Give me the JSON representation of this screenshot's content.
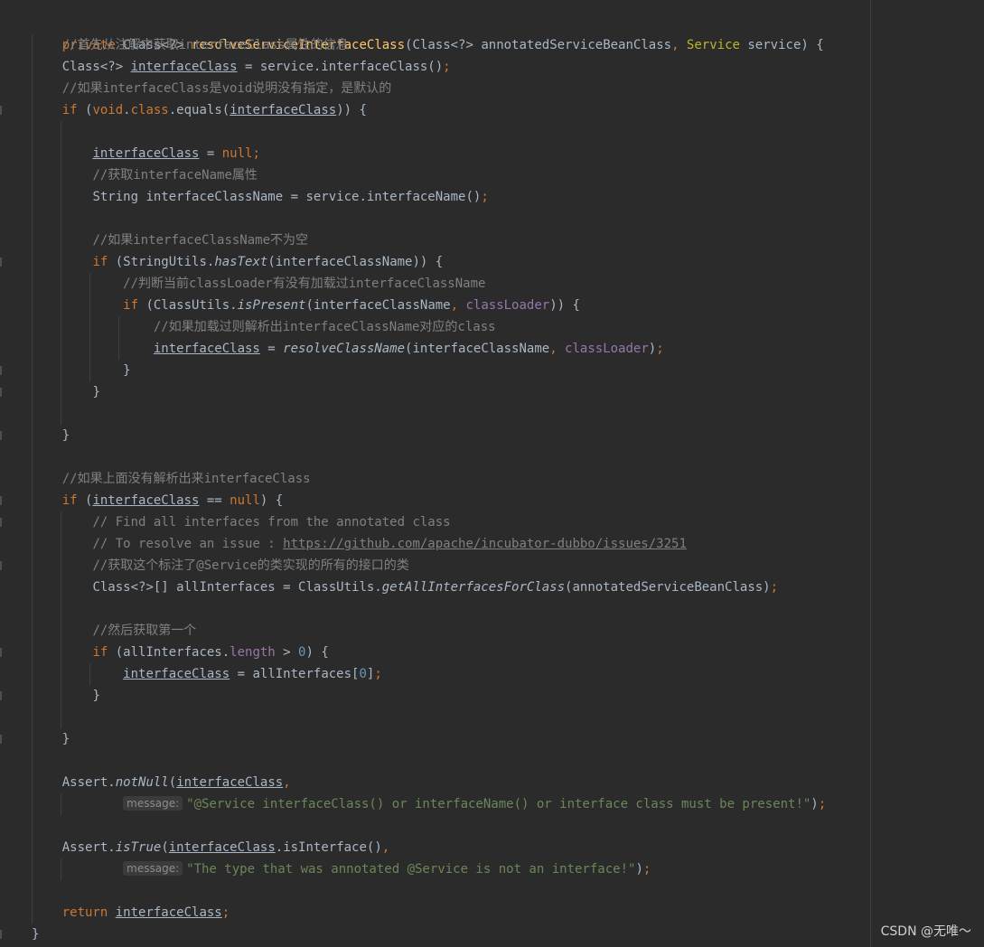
{
  "code": {
    "l1": {
      "mod": "private",
      "type": "Class<?> ",
      "method": "resolveServiceInterfaceClass",
      "params_a": "(Class<?> annotatedServiceBeanClass",
      "comma": ",",
      "svc_type": " Service",
      "params_b": " service) {"
    },
    "l2": {
      "comment": "//首先从注解中获取interfaceClass属性的信息"
    },
    "l3": {
      "type": "Class<?> ",
      "var": "interfaceClass",
      "rest": " = service.interfaceClass()",
      "semi": ";"
    },
    "l4": {
      "comment": "//如果interfaceClass是void说明没有指定，是默认的"
    },
    "l5": {
      "kw_if": "if",
      "p1": " (",
      "kw_void": "void",
      "dot": ".",
      "kw_class": "class",
      "p2": ".equals(",
      "var": "interfaceClass",
      "p3": ")) {"
    },
    "l7": {
      "var": "interfaceClass",
      "eq": " = ",
      "kw_null": "null",
      "semi": ";"
    },
    "l8": {
      "comment": "//获取interfaceName属性"
    },
    "l9": {
      "text": "String interfaceClassName = service.interfaceName()",
      "semi": ";"
    },
    "l11": {
      "comment": "//如果interfaceClassName不为空"
    },
    "l12": {
      "kw_if": "if",
      "p1": " (StringUtils.",
      "m": "hasText",
      "p2": "(interfaceClassName)) {"
    },
    "l13": {
      "comment": "//判断当前classLoader有没有加载过interfaceClassName"
    },
    "l14": {
      "kw_if": "if",
      "p1": " (ClassUtils.",
      "m": "isPresent",
      "p2": "(interfaceClassName",
      "comma": ",",
      "fld": " classLoader",
      "p3": ")) {"
    },
    "l15": {
      "comment": "//如果加载过则解析出interfaceClassName对应的class"
    },
    "l16": {
      "var": "interfaceClass",
      "eq": " = ",
      "m": "resolveClassName",
      "p1": "(interfaceClassName",
      "comma": ",",
      "fld": " classLoader",
      "p2": ")",
      "semi": ";"
    },
    "l17": {
      "brace": "}"
    },
    "l18": {
      "brace": "}"
    },
    "l20": {
      "brace": "}"
    },
    "l22": {
      "comment": "//如果上面没有解析出来interfaceClass"
    },
    "l23": {
      "kw_if": "if",
      "p1": " (",
      "var": "interfaceClass",
      "p2": " == ",
      "kw_null": "null",
      "p3": ") {"
    },
    "l24": {
      "comment": "// Find all interfaces from the annotated class"
    },
    "l25": {
      "comment": "// To resolve an issue : ",
      "link": "https://github.com/apache/incubator-dubbo/issues/3251"
    },
    "l26": {
      "comment": "//获取这个标注了@Service的类实现的所有的接口的类"
    },
    "l27": {
      "p1": "Class<?>[] allInterfaces = ClassUtils.",
      "m": "getAllInterfacesForClass",
      "p2": "(annotatedServiceBeanClass)",
      "semi": ";"
    },
    "l29": {
      "comment": "//然后获取第一个"
    },
    "l30": {
      "kw_if": "if",
      "p1": " (allInterfaces.",
      "fld": "length",
      "p2": " > ",
      "num": "0",
      "p3": ") {"
    },
    "l31": {
      "var": "interfaceClass",
      "p1": " = allInterfaces[",
      "num": "0",
      "p2": "]",
      "semi": ";"
    },
    "l32": {
      "brace": "}"
    },
    "l34": {
      "brace": "}"
    },
    "l36": {
      "p1": "Assert.",
      "m": "notNull",
      "p2": "(",
      "var": "interfaceClass",
      "comma": ","
    },
    "l37": {
      "hint": "message:",
      "str": "\"@Service interfaceClass() or interfaceName() or interface class must be present!\"",
      "p1": ")",
      "semi": ";"
    },
    "l39": {
      "p1": "Assert.",
      "m": "isTrue",
      "p2": "(",
      "var": "interfaceClass",
      "p3": ".isInterface()",
      "comma": ","
    },
    "l40": {
      "hint": "message:",
      "str": "\"The type that was annotated @Service is not an interface!\"",
      "p1": ")",
      "semi": ";"
    },
    "l42": {
      "kw_return": "return",
      "sp": " ",
      "var": "interfaceClass",
      "semi": ";"
    },
    "l43": {
      "brace": "}"
    }
  },
  "watermark": "CSDN @无唯～",
  "colors": {
    "background": "#2b2b2b",
    "keyword": "#cc7832",
    "method": "#ffc66d",
    "comment": "#808080",
    "string": "#6a8759",
    "number": "#6897bb",
    "field": "#9876aa"
  }
}
